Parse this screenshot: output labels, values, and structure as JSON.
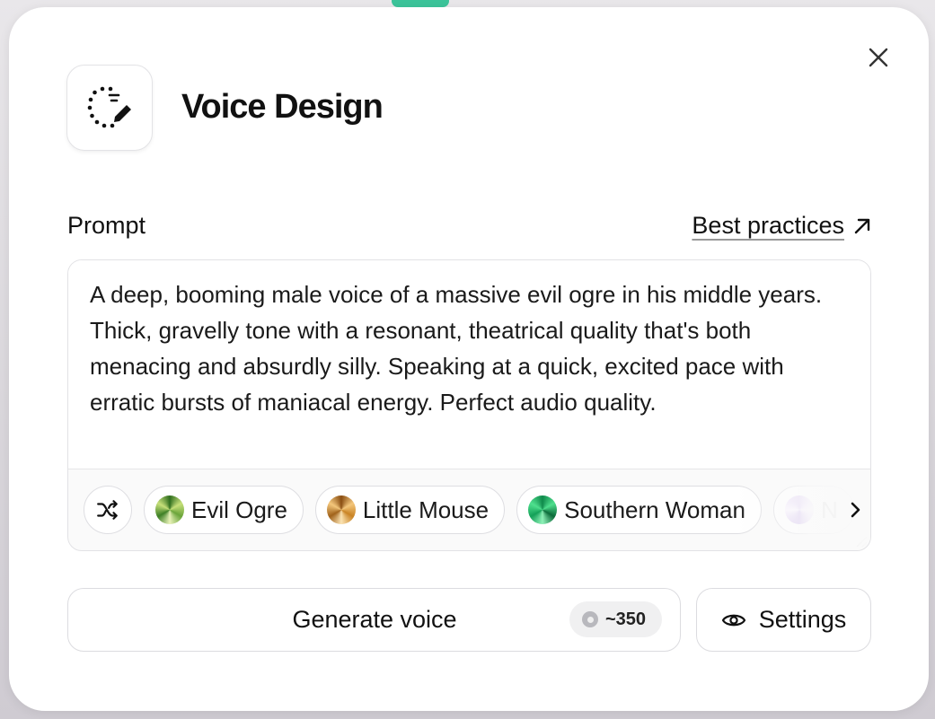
{
  "dialog": {
    "title": "Voice Design",
    "header_icon": "voice-design-icon",
    "close_icon": "close-icon"
  },
  "prompt": {
    "label": "Prompt",
    "best_practices_label": "Best practices",
    "best_practices_icon": "arrow-up-right-icon",
    "value": "A deep, booming male voice of a massive evil ogre in his middle years. Thick, gravelly tone with a resonant, theatrical quality that's both menacing and absurdly silly. Speaking at a quick, excited pace with erratic bursts of maniacal energy. Perfect audio quality."
  },
  "presets": {
    "shuffle_icon": "shuffle-icon",
    "scroll_icon": "chevron-right-icon",
    "items": [
      {
        "label": "Evil Ogre",
        "orb_colors": [
          "#2f6e1e",
          "#c7e07a"
        ]
      },
      {
        "label": "Little Mouse",
        "orb_colors": [
          "#8a4e12",
          "#f4c77c"
        ]
      },
      {
        "label": "Southern Woman",
        "orb_colors": [
          "#0f8a4b",
          "#4fe08e"
        ]
      },
      {
        "label": "N",
        "orb_colors": [
          "#d9c6f2",
          "#f5ecfd"
        ]
      }
    ]
  },
  "actions": {
    "generate_label": "Generate voice",
    "credits": "~350",
    "credit_icon": "credit-coin-icon",
    "settings_label": "Settings",
    "settings_icon": "eye-icon"
  }
}
